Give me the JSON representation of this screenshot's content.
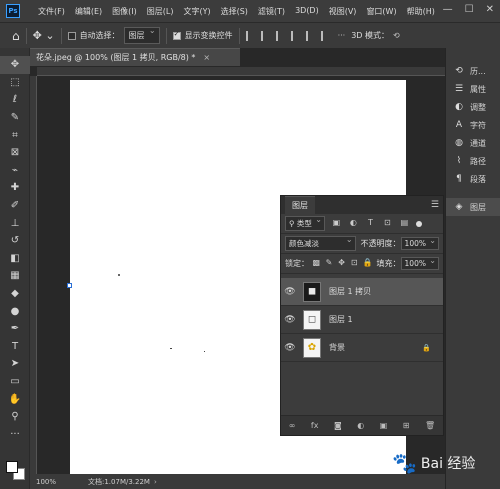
{
  "app": {
    "logo": "Ps"
  },
  "menu": [
    "文件(F)",
    "编辑(E)",
    "图像(I)",
    "图层(L)",
    "文字(Y)",
    "选择(S)",
    "滤镜(T)",
    "3D(D)",
    "视图(V)",
    "窗口(W)",
    "帮助(H)"
  ],
  "window_controls": {
    "minimize": "—",
    "maximize": "☐",
    "close": "✕"
  },
  "options": {
    "auto_select_label": "自动选择：",
    "auto_select_value": "图层",
    "show_transform_label": "显示变换控件",
    "mode_3d_label": "3D 模式："
  },
  "document": {
    "tab_title": "花朵.jpeg @ 100% (图层 1 拷贝, RGB/8) *",
    "tab_close": "×",
    "zoom": "100%",
    "doc_info": "文档:1.07M/3.22M"
  },
  "tools": [
    {
      "name": "move-tool-icon",
      "glyph": "✥"
    },
    {
      "name": "marquee-tool-icon",
      "glyph": "⬚"
    },
    {
      "name": "lasso-tool-icon",
      "glyph": "ℓ"
    },
    {
      "name": "quick-select-tool-icon",
      "glyph": "✎"
    },
    {
      "name": "crop-tool-icon",
      "glyph": "⌗"
    },
    {
      "name": "frame-tool-icon",
      "glyph": "⊠"
    },
    {
      "name": "eyedropper-tool-icon",
      "glyph": "⌁"
    },
    {
      "name": "healing-tool-icon",
      "glyph": "✚"
    },
    {
      "name": "brush-tool-icon",
      "glyph": "✐"
    },
    {
      "name": "stamp-tool-icon",
      "glyph": "⊥"
    },
    {
      "name": "history-brush-icon",
      "glyph": "↺"
    },
    {
      "name": "eraser-tool-icon",
      "glyph": "◧"
    },
    {
      "name": "gradient-tool-icon",
      "glyph": "▦"
    },
    {
      "name": "blur-tool-icon",
      "glyph": "◆"
    },
    {
      "name": "dodge-tool-icon",
      "glyph": "●"
    },
    {
      "name": "pen-tool-icon",
      "glyph": "✒"
    },
    {
      "name": "type-tool-icon",
      "glyph": "T"
    },
    {
      "name": "path-select-tool-icon",
      "glyph": "➤"
    },
    {
      "name": "shape-tool-icon",
      "glyph": "▭"
    },
    {
      "name": "hand-tool-icon",
      "glyph": "✋"
    },
    {
      "name": "zoom-tool-icon",
      "glyph": "⚲"
    },
    {
      "name": "more-tools-icon",
      "glyph": "···"
    }
  ],
  "right_panels": [
    {
      "icon": "history-icon",
      "glyph": "⟲",
      "label": "历..."
    },
    {
      "icon": "properties-icon",
      "glyph": "☰",
      "label": "属性"
    },
    {
      "icon": "adjustments-icon",
      "glyph": "◐",
      "label": "调整"
    },
    {
      "icon": "character-icon",
      "glyph": "A",
      "label": "字符"
    },
    {
      "icon": "channels-icon",
      "glyph": "◍",
      "label": "通道"
    },
    {
      "icon": "paths-icon",
      "glyph": "⌇",
      "label": "路径"
    },
    {
      "icon": "paragraph-icon",
      "glyph": "¶",
      "label": "段落"
    },
    {
      "icon": "layers-icon",
      "glyph": "◈",
      "label": "图层"
    }
  ],
  "layers_panel": {
    "tab": "图层",
    "filter_kind": "类型",
    "blend_mode": "颜色减淡",
    "opacity_label": "不透明度：",
    "opacity_value": "100%",
    "lock_label": "锁定：",
    "fill_label": "填充：",
    "fill_value": "100%",
    "layers": [
      {
        "name": "图层 1 拷贝",
        "selected": true,
        "thumb": "◼"
      },
      {
        "name": "图层 1",
        "selected": false,
        "thumb": "◻"
      },
      {
        "name": "背景",
        "selected": false,
        "thumb": "✿",
        "locked": true
      }
    ],
    "footer": [
      "∞",
      "fx",
      "◙",
      "◐",
      "▣",
      "⊞",
      "🗑"
    ]
  },
  "watermark": "Bai 经验"
}
